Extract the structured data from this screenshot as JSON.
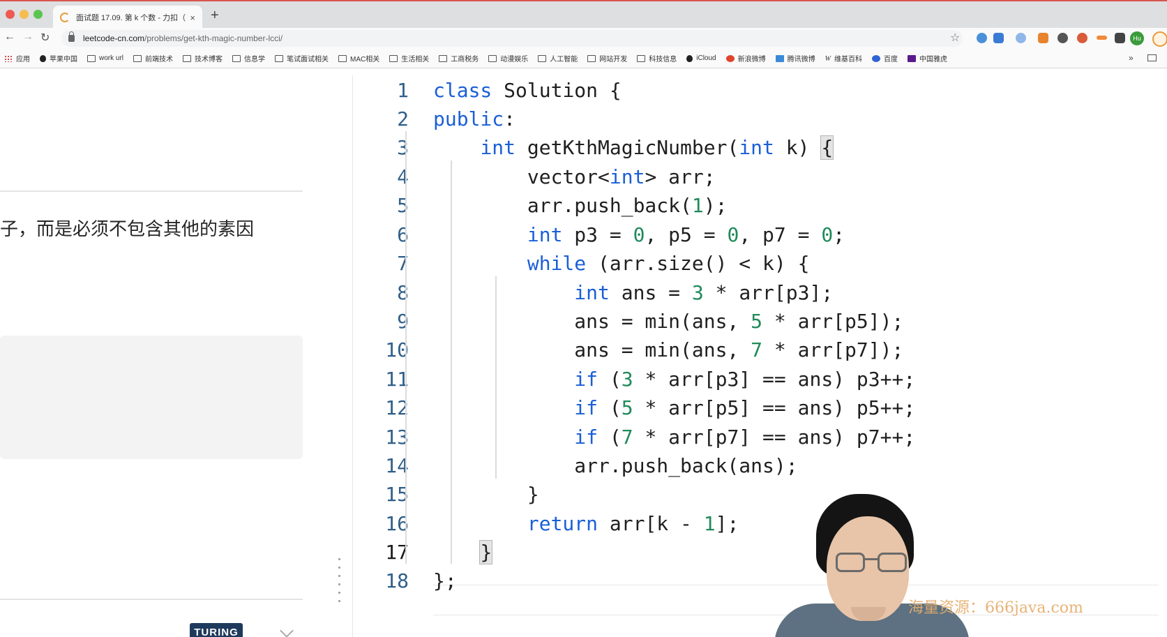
{
  "browser": {
    "tab_title": "面试题 17.09. 第 k 个数 - 力扣（",
    "tab_close": "×",
    "new_tab": "+",
    "url_domain": "leetcode-cn.com",
    "url_path": "/problems/get-kth-magic-number-lcci/",
    "profile_initials": "Hu",
    "bookmarks": [
      {
        "label": "应用",
        "icon": "apps-grid-icon"
      },
      {
        "label": "苹果中国",
        "icon": "apple-icon"
      },
      {
        "label": "work url",
        "icon": "folder-icon"
      },
      {
        "label": "前端技术",
        "icon": "folder-icon"
      },
      {
        "label": "技术博客",
        "icon": "folder-icon"
      },
      {
        "label": "信息学",
        "icon": "folder-icon"
      },
      {
        "label": "笔试面试相关",
        "icon": "folder-icon"
      },
      {
        "label": "MAC相关",
        "icon": "folder-icon"
      },
      {
        "label": "生活相关",
        "icon": "folder-icon"
      },
      {
        "label": "工商税务",
        "icon": "folder-icon"
      },
      {
        "label": "动漫娱乐",
        "icon": "folder-icon"
      },
      {
        "label": "人工智能",
        "icon": "folder-icon"
      },
      {
        "label": "网站开发",
        "icon": "folder-icon"
      },
      {
        "label": "科技信息",
        "icon": "folder-icon"
      },
      {
        "label": "iCloud",
        "icon": "apple-icon"
      },
      {
        "label": "新浪微博",
        "icon": "weibo-icon"
      },
      {
        "label": "腾讯微博",
        "icon": "tencent-weibo-icon"
      },
      {
        "label": "维基百科",
        "icon": "wikipedia-icon"
      },
      {
        "label": "百度",
        "icon": "baidu-icon"
      },
      {
        "label": "中国雅虎",
        "icon": "yahoo-icon"
      }
    ],
    "bookmarks_more": "»"
  },
  "problem": {
    "description_fragment": "子，而是必须不包含其他的素因",
    "logo_text": "TURING"
  },
  "editor": {
    "line_numbers": [
      "1",
      "2",
      "3",
      "4",
      "5",
      "6",
      "7",
      "8",
      "9",
      "10",
      "11",
      "12",
      "13",
      "14",
      "15",
      "16",
      "17",
      "18"
    ],
    "active_line": "17"
  },
  "watermark": "海量资源：666java.com",
  "colors": {
    "keyword": "#1a5fd6",
    "number": "#1f8a5a",
    "line_number": "#2f5f8a",
    "tab_accent": "#d9534f"
  }
}
